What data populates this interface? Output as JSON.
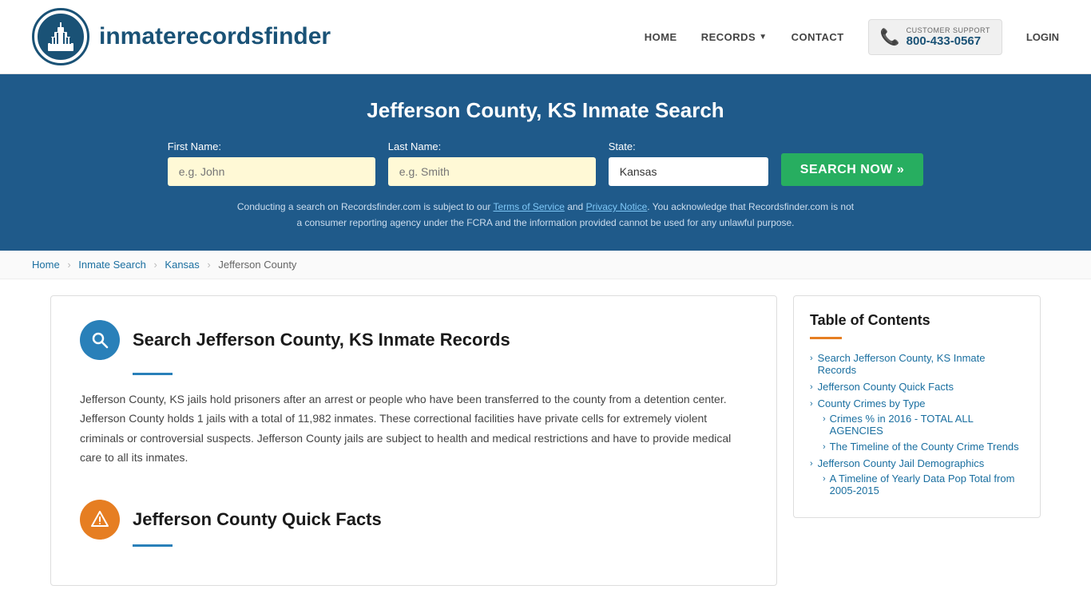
{
  "header": {
    "logo_text_main": "inmaterecords",
    "logo_text_bold": "finder",
    "nav": {
      "home": "HOME",
      "records": "RECORDS",
      "contact": "CONTACT",
      "login": "LOGIN"
    },
    "customer_support": {
      "label": "CUSTOMER SUPPORT",
      "phone": "800-433-0567"
    }
  },
  "hero": {
    "title": "Jefferson County, KS Inmate Search",
    "first_name_label": "First Name:",
    "first_name_placeholder": "e.g. John",
    "last_name_label": "Last Name:",
    "last_name_placeholder": "e.g. Smith",
    "state_label": "State:",
    "state_value": "Kansas",
    "search_button": "SEARCH NOW »",
    "disclaimer": "Conducting a search on Recordsfinder.com is subject to our Terms of Service and Privacy Notice. You acknowledge that Recordsfinder.com is not a consumer reporting agency under the FCRA and the information provided cannot be used for any unlawful purpose."
  },
  "breadcrumb": {
    "items": [
      "Home",
      "Inmate Search",
      "Kansas",
      "Jefferson County"
    ]
  },
  "main": {
    "section1": {
      "icon": "🔍",
      "title": "Search Jefferson County, KS Inmate Records",
      "body": "Jefferson County, KS jails hold prisoners after an arrest or people who have been transferred to the county from a detention center. Jefferson County holds 1 jails with a total of 11,982 inmates. These correctional facilities have private cells for extremely violent criminals or controversial suspects. Jefferson County jails are subject to health and medical restrictions and have to provide medical care to all its inmates."
    },
    "section2": {
      "icon": "⚠",
      "title": "Jefferson County Quick Facts"
    }
  },
  "sidebar": {
    "toc_title": "Table of Contents",
    "items": [
      {
        "label": "Search Jefferson County, KS Inmate Records",
        "sub": []
      },
      {
        "label": "Jefferson County Quick Facts",
        "sub": []
      },
      {
        "label": "County Crimes by Type",
        "sub": [
          "Crimes % in 2016 - TOTAL ALL AGENCIES",
          "The Timeline of the County Crime Trends"
        ]
      },
      {
        "label": "Jefferson County Jail Demographics",
        "sub": [
          "A Timeline of Yearly Data Pop Total from 2005-2015"
        ]
      }
    ]
  }
}
